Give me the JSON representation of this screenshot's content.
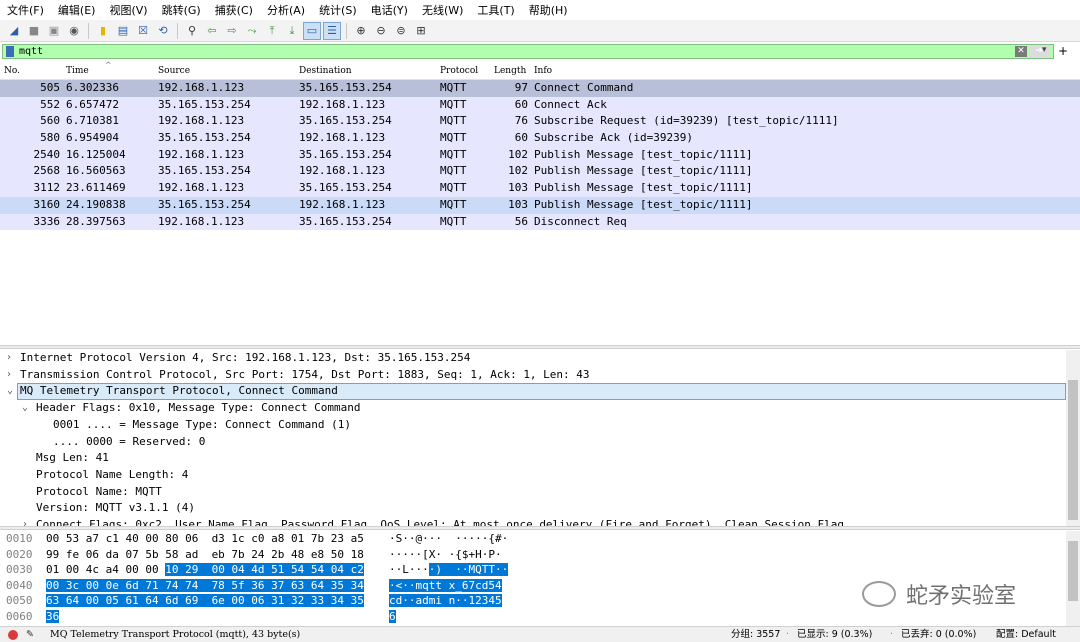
{
  "menu": [
    "文件(F)",
    "编辑(E)",
    "视图(V)",
    "跳转(G)",
    "捕获(C)",
    "分析(A)",
    "统计(S)",
    "电话(Y)",
    "无线(W)",
    "工具(T)",
    "帮助(H)"
  ],
  "toolbar": {
    "icons": [
      "shark-fin-start-icon",
      "stop-icon",
      "restart-icon",
      "options-gear-icon",
      "open-file-icon",
      "save-file-icon",
      "close-file-icon",
      "reload-icon",
      "find-packet-icon",
      "go-back-icon",
      "go-forward-icon",
      "go-to-packet-icon",
      "first-packet-icon",
      "last-packet-icon",
      "autoscroll-icon",
      "colorize-icon",
      "zoom-in-icon",
      "zoom-out-icon",
      "normal-size-icon",
      "resize-columns-icon"
    ]
  },
  "filter": {
    "value": "mqtt"
  },
  "columns": [
    "No.",
    "Time",
    "Source",
    "Destination",
    "Protocol",
    "Length",
    "Info"
  ],
  "packets": [
    {
      "no": "505",
      "time": "6.302336",
      "src": "192.168.1.123",
      "dst": "35.165.153.254",
      "proto": "MQTT",
      "len": "97",
      "info": "Connect Command"
    },
    {
      "no": "552",
      "time": "6.657472",
      "src": "35.165.153.254",
      "dst": "192.168.1.123",
      "proto": "MQTT",
      "len": "60",
      "info": "Connect Ack"
    },
    {
      "no": "560",
      "time": "6.710381",
      "src": "192.168.1.123",
      "dst": "35.165.153.254",
      "proto": "MQTT",
      "len": "76",
      "info": "Subscribe Request (id=39239) [test_topic/1111]"
    },
    {
      "no": "580",
      "time": "6.954904",
      "src": "35.165.153.254",
      "dst": "192.168.1.123",
      "proto": "MQTT",
      "len": "60",
      "info": "Subscribe Ack (id=39239)"
    },
    {
      "no": "2540",
      "time": "16.125004",
      "src": "192.168.1.123",
      "dst": "35.165.153.254",
      "proto": "MQTT",
      "len": "102",
      "info": "Publish Message [test_topic/1111]"
    },
    {
      "no": "2568",
      "time": "16.560563",
      "src": "35.165.153.254",
      "dst": "192.168.1.123",
      "proto": "MQTT",
      "len": "102",
      "info": "Publish Message [test_topic/1111]"
    },
    {
      "no": "3112",
      "time": "23.611469",
      "src": "192.168.1.123",
      "dst": "35.165.153.254",
      "proto": "MQTT",
      "len": "103",
      "info": "Publish Message [test_topic/1111]"
    },
    {
      "no": "3160",
      "time": "24.190838",
      "src": "35.165.153.254",
      "dst": "192.168.1.123",
      "proto": "MQTT",
      "len": "103",
      "info": "Publish Message [test_topic/1111]"
    },
    {
      "no": "3336",
      "time": "28.397563",
      "src": "192.168.1.123",
      "dst": "35.165.153.254",
      "proto": "MQTT",
      "len": "56",
      "info": "Disconnect Req"
    }
  ],
  "details": [
    "Internet Protocol Version 4, Src: 192.168.1.123, Dst: 35.165.153.254",
    "Transmission Control Protocol, Src Port: 1754, Dst Port: 1883, Seq: 1, Ack: 1, Len: 43",
    "MQ Telemetry Transport Protocol, Connect Command",
    "Header Flags: 0x10, Message Type: Connect Command",
    "0001 .... = Message Type: Connect Command (1)",
    ".... 0000 = Reserved: 0",
    "Msg Len: 41",
    "Protocol Name Length: 4",
    "Protocol Name: MQTT",
    "Version: MQTT v3.1.1 (4)",
    "Connect Flags: 0xc2, User Name Flag, Password Flag, QoS Level: At most once delivery (Fire and Forget), Clean Session Flag"
  ],
  "hex": [
    {
      "off": "0010",
      "b1": "00 53 a7 c1 40 00 80 06  d3 1c c0 a8 01 7b 23 a5",
      "b2": "",
      "a1": "·S··@···  ·····{#·",
      "a2": ""
    },
    {
      "off": "0020",
      "b1": "99 fe 06 da 07 5b 58 ad  eb 7b 24 2b 48 e8 50 18",
      "b2": "",
      "a1": "·····[X· ·{$+H·P·",
      "a2": ""
    },
    {
      "off": "0030",
      "b1": "01 00 4c a4 00 00 ",
      "b2": "10 29  00 04 4d 51 54 54 04 c2",
      "a1": "··L···",
      "a2": "·)  ··MQTT··"
    },
    {
      "off": "0040",
      "b1": "",
      "b2": "00 3c 00 0e 6d 71 74 74  78 5f 36 37 63 64 35 34",
      "a1": "",
      "a2": "·<··mqtt x_67cd54"
    },
    {
      "off": "0050",
      "b1": "",
      "b2": "63 64 00 05 61 64 6d 69  6e 00 06 31 32 33 34 35",
      "a1": "",
      "a2": "cd··admi n··12345"
    },
    {
      "off": "0060",
      "b1": "",
      "b2": "36",
      "a1": "",
      "a2": "6"
    }
  ],
  "watermark": "蛇矛实验室",
  "status": {
    "file": "MQ Telemetry Transport Protocol (mqtt), 43 byte(s)",
    "groups": "分组: 3557",
    "displayed": "已显示: 9 (0.3%)",
    "dropped": "已丢弃: 0 (0.0%)",
    "profile": "配置: Default"
  }
}
